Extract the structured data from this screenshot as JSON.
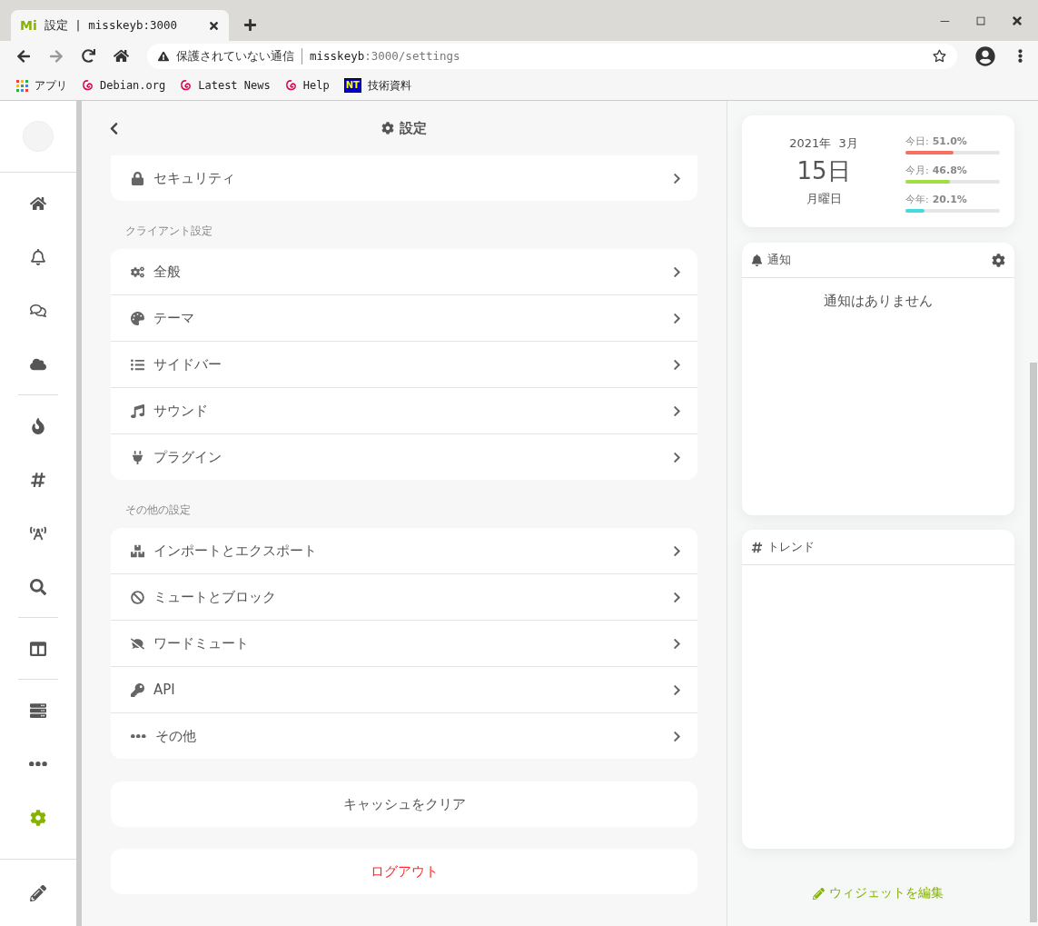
{
  "browser": {
    "tab": {
      "favicon": "Mi",
      "title": "設定 | misskeyb:3000",
      "selected": true
    },
    "address": {
      "security": "保護されていない通信",
      "host": "misskeyb",
      "path": ":3000/settings"
    },
    "bookmarks": [
      {
        "kind": "apps",
        "label": "アプリ"
      },
      {
        "kind": "debian",
        "label": "Debian.org"
      },
      {
        "kind": "debian",
        "label": "Latest News"
      },
      {
        "kind": "debian",
        "label": "Help"
      },
      {
        "kind": "badge",
        "badge": "NT",
        "label": "技術資料"
      }
    ]
  },
  "sidebar": {
    "groups": [
      [
        {
          "kind": "home",
          "selected": false
        },
        {
          "kind": "bell",
          "selected": false
        },
        {
          "kind": "chat",
          "selected": false
        },
        {
          "kind": "cloud",
          "selected": false
        }
      ],
      [
        {
          "kind": "fire",
          "selected": false
        },
        {
          "kind": "hashtag",
          "selected": false
        },
        {
          "kind": "antenna",
          "selected": false
        },
        {
          "kind": "search",
          "selected": false
        }
      ],
      [
        {
          "kind": "columns",
          "selected": false
        }
      ],
      [
        {
          "kind": "server",
          "selected": false
        },
        {
          "kind": "more",
          "selected": false
        },
        {
          "kind": "settings",
          "selected": true
        }
      ]
    ]
  },
  "header": {
    "title": "設定"
  },
  "sections": [
    {
      "items": [
        {
          "kind": "lock",
          "label": "セキュリティ"
        }
      ]
    },
    {
      "label": "クライアント設定",
      "items": [
        {
          "kind": "cogs",
          "label": "全般"
        },
        {
          "kind": "palette",
          "label": "テーマ"
        },
        {
          "kind": "list",
          "label": "サイドバー"
        },
        {
          "kind": "music",
          "label": "サウンド"
        },
        {
          "kind": "plug",
          "label": "プラグイン"
        }
      ]
    },
    {
      "label": "その他の設定",
      "items": [
        {
          "kind": "boxes",
          "label": "インポートとエクスポート"
        },
        {
          "kind": "ban",
          "label": "ミュートとブロック"
        },
        {
          "kind": "commentslash",
          "label": "ワードミュート"
        },
        {
          "kind": "key",
          "label": "API"
        },
        {
          "kind": "dots",
          "label": "その他"
        }
      ]
    }
  ],
  "actions": [
    {
      "kind": "normal",
      "label": "キャッシュをクリア"
    },
    {
      "kind": "danger",
      "label": "ログアウト"
    }
  ],
  "calendar": {
    "year_month": "2021年  3月",
    "day": "15日",
    "weekday": "月曜日",
    "meters": [
      {
        "label": "今日:",
        "value": "51.0%",
        "level": 0.51,
        "color": "#f87060"
      },
      {
        "label": "今月:",
        "value": "46.8%",
        "level": 0.468,
        "color": "#a1de41"
      },
      {
        "label": "今年:",
        "value": "20.1%",
        "level": 0.201,
        "color": "#41dddd"
      }
    ]
  },
  "notifications": {
    "title": "通知",
    "empty": "通知はありません"
  },
  "trends": {
    "title": "トレンド"
  },
  "edit_widgets": "ウィジェットを編集"
}
